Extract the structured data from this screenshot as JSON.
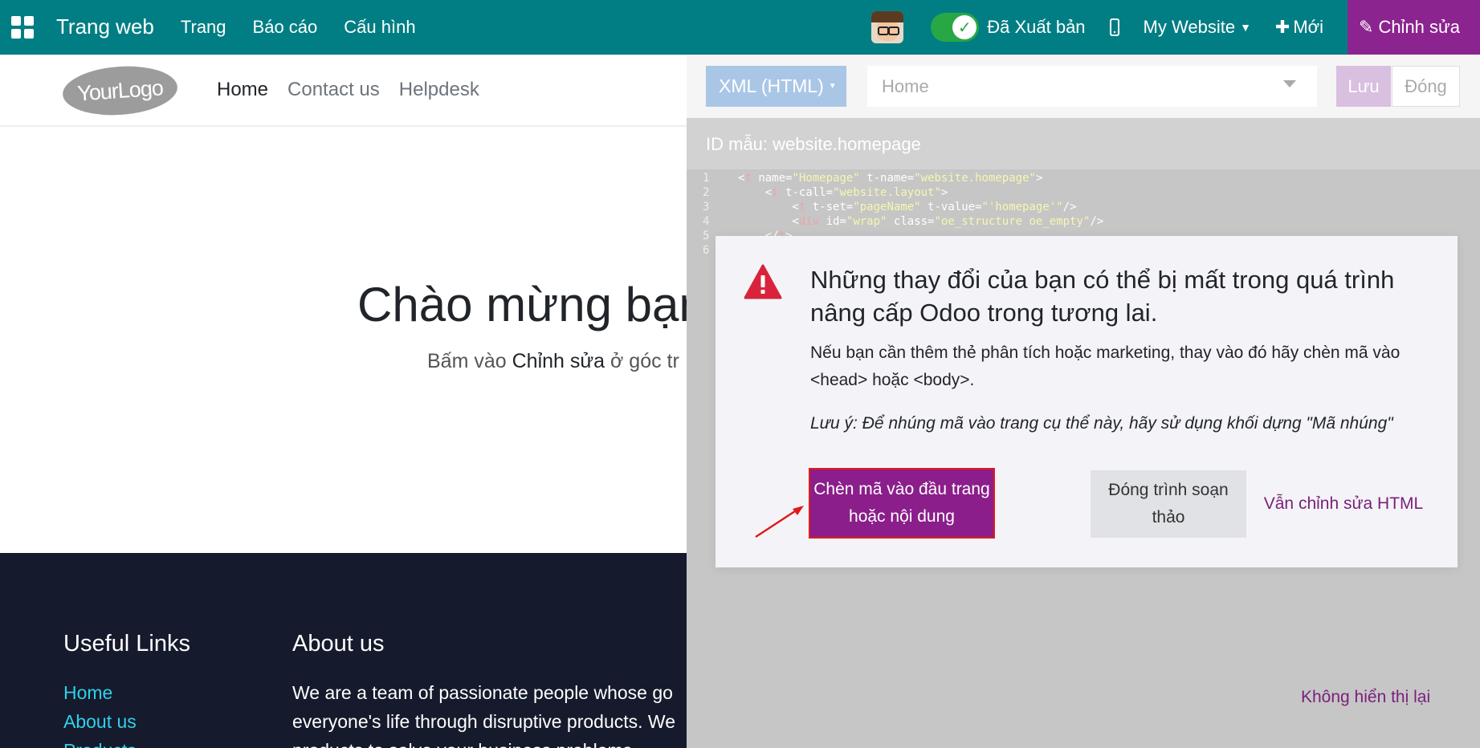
{
  "navbar": {
    "app_name": "Trang web",
    "menu": [
      "Trang",
      "Báo cáo",
      "Cấu hình"
    ],
    "published_label": "Đã Xuất bản",
    "website_label": "My Website",
    "new_label": "Mới",
    "edit_label": "Chỉnh sửa",
    "accent_color": "#017e84",
    "edit_color": "#8c248f"
  },
  "site": {
    "logo": "YourLogo",
    "nav": [
      "Home",
      "Contact us",
      "Helpdesk"
    ],
    "hero_title": "Chào mừng bạn",
    "hero_sub_pre": "Bấm vào ",
    "hero_sub_bold": "Chỉnh sửa",
    "hero_sub_post": " ở góc tr"
  },
  "footer": {
    "col1_title": "Useful Links",
    "links": [
      "Home",
      "About us",
      "Products"
    ],
    "col2_title": "About us",
    "about_lines": [
      "We are a team of passionate people whose go",
      "everyone's life through disruptive products. We",
      "products to solve your business problems."
    ]
  },
  "editor": {
    "mode": "XML (HTML)",
    "page": "Home",
    "save": "Lưu",
    "close": "Đóng",
    "template_id": "ID mẫu: website.homepage",
    "code_lines": [
      "1",
      "2",
      "3",
      "4",
      "5",
      "6"
    ]
  },
  "modal": {
    "title": "Những thay đổi của bạn có thể bị mất trong quá trình nâng cấp Odoo trong tương lai.",
    "body": "Nếu bạn cần thêm thẻ phân tích hoặc marketing, thay vào đó hãy chèn mã vào <head> hoặc <body>.",
    "note": "Lưu ý: Để nhúng mã vào trang cụ thể này, hãy sử dụng khối dựng \"Mã nhúng\"",
    "primary_button": "Chèn mã vào đầu trang hoặc nội dung",
    "secondary_button": "Đóng trình soạn thảo",
    "link_button": "Vẫn chỉnh sửa HTML",
    "dont_show": "Không hiển thị lại",
    "primary_color": "#8b1e8b",
    "warning_color": "#d9233c"
  }
}
